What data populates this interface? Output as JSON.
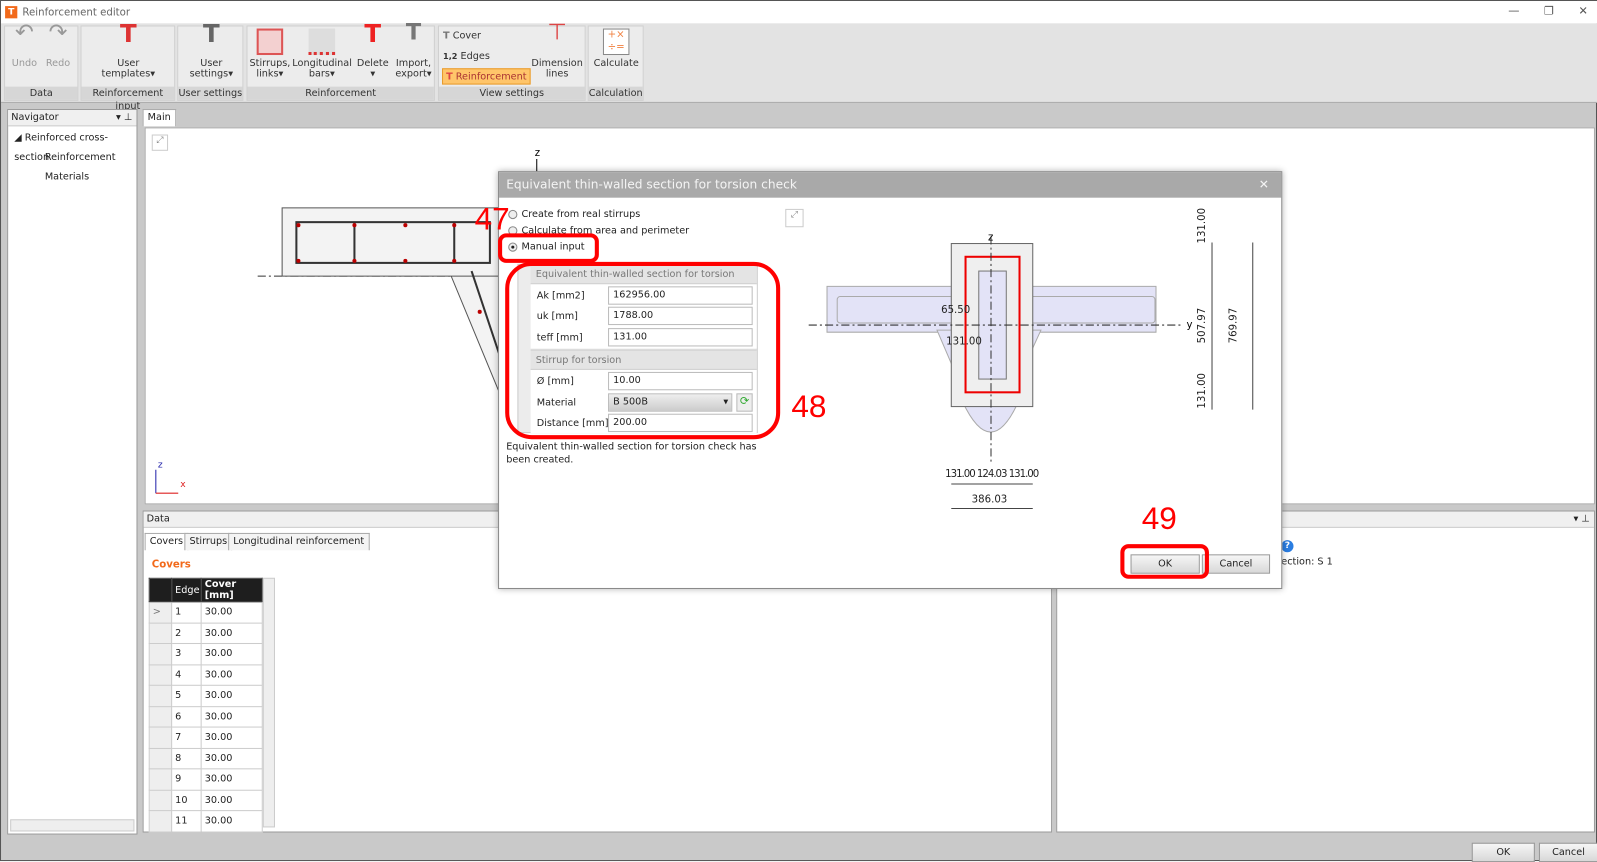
{
  "window": {
    "title": "Reinforcement editor",
    "icon": "T"
  },
  "ribbon": {
    "groups": [
      {
        "label": "Data"
      },
      {
        "label": "Reinforcement input"
      },
      {
        "label": "User settings"
      },
      {
        "label": "Reinforcement"
      },
      {
        "label": "View settings"
      },
      {
        "label": "Calculation"
      }
    ],
    "undo": "Undo",
    "redo": "Redo",
    "user_templates": "User\ntemplates",
    "user_settings": "User\nsettings",
    "stirrups": "Stirrups,\nlinks",
    "longitudinal": "Longitudinal\nbars",
    "delete": "Delete",
    "import_export": "Import,\nexport",
    "cover": "Cover",
    "edges": "Edges",
    "edges_prefix": "1,2",
    "reinforcement": "Reinforcement",
    "dimension_lines": "Dimension\nlines",
    "calculate": "Calculate"
  },
  "navigator": {
    "title": "Navigator",
    "items": [
      "Reinforced cross-section",
      "Reinforcement",
      "Materials"
    ]
  },
  "main_tab": "Main",
  "axes": {
    "z": "z",
    "x": "x",
    "y": "y"
  },
  "data_panel": {
    "title": "Data",
    "tabs": [
      "Covers",
      "Stirrups",
      "Longitudinal reinforcement"
    ],
    "section": "Covers",
    "columns": [
      "Edge",
      "Cover [mm]"
    ],
    "rows": [
      [
        "1",
        "30.00"
      ],
      [
        "2",
        "30.00"
      ],
      [
        "3",
        "30.00"
      ],
      [
        "4",
        "30.00"
      ],
      [
        "5",
        "30.00"
      ],
      [
        "6",
        "30.00"
      ],
      [
        "7",
        "30.00"
      ],
      [
        "8",
        "30.00"
      ],
      [
        "9",
        "30.00"
      ],
      [
        "10",
        "30.00"
      ],
      [
        "11",
        "30.00"
      ]
    ]
  },
  "right_panel": {
    "text": "ection: S 1"
  },
  "dialog": {
    "title": "Equivalent thin-walled section for torsion check",
    "options": [
      {
        "label": "Create from real stirrups",
        "selected": false
      },
      {
        "label": "Calculate from area and perimeter",
        "selected": false
      },
      {
        "label": "Manual input",
        "selected": true
      }
    ],
    "section1": "Equivalent thin-walled section for torsion check",
    "fields1": [
      {
        "label": "Ak [mm2]",
        "value": "162956.00"
      },
      {
        "label": "uk [mm]",
        "value": "1788.00"
      },
      {
        "label": "teff [mm]",
        "value": "131.00"
      }
    ],
    "section2": "Stirrup for torsion",
    "diameter": {
      "label": "Ø [mm]",
      "value": "10.00"
    },
    "material": {
      "label": "Material",
      "value": "B 500B"
    },
    "distance": {
      "label": "Distance [mm]",
      "value": "200.00"
    },
    "message": "Equivalent thin-walled section for torsion check  has been created.",
    "ok": "OK",
    "cancel": "Cancel",
    "dims": {
      "top": "131.00",
      "middle": "507.97",
      "bottom": "131.00",
      "total": "769.97",
      "w1": "131.00",
      "w2": "124.03",
      "w3": "131.00",
      "width": "386.03",
      "inner": "131.00",
      "small": "65.50"
    }
  },
  "footer": {
    "ok": "OK",
    "cancel": "Cancel"
  },
  "annotations": [
    "47",
    "48",
    "49"
  ],
  "colors": {
    "annotation": "#ff0000",
    "accent": "#f26a1b",
    "section_fill": "#e3e3f7"
  }
}
